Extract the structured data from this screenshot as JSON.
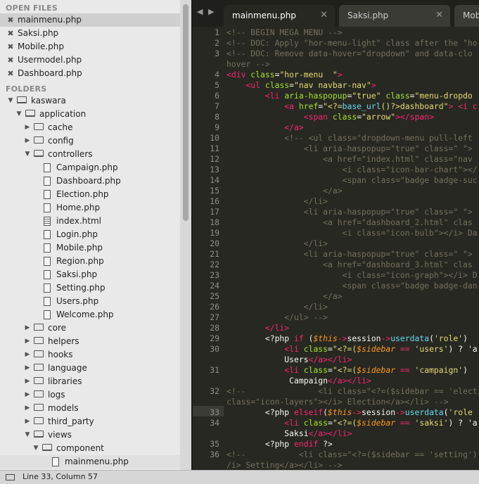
{
  "sidebar": {
    "open_files_title": "OPEN FILES",
    "open_files": [
      {
        "name": "mainmenu.php",
        "close": "✖"
      },
      {
        "name": "Saksi.php",
        "close": "✖"
      },
      {
        "name": "Mobile.php",
        "close": "✖"
      },
      {
        "name": "Usermodel.php",
        "close": "✖"
      },
      {
        "name": "Dashboard.php",
        "close": "✖"
      }
    ],
    "folders_title": "FOLDERS",
    "tree": [
      {
        "label": "kaswara",
        "depth": 0,
        "kind": "folder",
        "open": true
      },
      {
        "label": "application",
        "depth": 1,
        "kind": "folder",
        "open": true
      },
      {
        "label": "cache",
        "depth": 2,
        "kind": "folder",
        "open": false
      },
      {
        "label": "config",
        "depth": 2,
        "kind": "folder",
        "open": false
      },
      {
        "label": "controllers",
        "depth": 2,
        "kind": "folder",
        "open": true
      },
      {
        "label": "Campaign.php",
        "depth": 3,
        "kind": "file"
      },
      {
        "label": "Dashboard.php",
        "depth": 3,
        "kind": "file"
      },
      {
        "label": "Election.php",
        "depth": 3,
        "kind": "file"
      },
      {
        "label": "Home.php",
        "depth": 3,
        "kind": "file"
      },
      {
        "label": "index.html",
        "depth": 3,
        "kind": "file-lines"
      },
      {
        "label": "Login.php",
        "depth": 3,
        "kind": "file"
      },
      {
        "label": "Mobile.php",
        "depth": 3,
        "kind": "file"
      },
      {
        "label": "Region.php",
        "depth": 3,
        "kind": "file"
      },
      {
        "label": "Saksi.php",
        "depth": 3,
        "kind": "file"
      },
      {
        "label": "Setting.php",
        "depth": 3,
        "kind": "file"
      },
      {
        "label": "Users.php",
        "depth": 3,
        "kind": "file"
      },
      {
        "label": "Welcome.php",
        "depth": 3,
        "kind": "file"
      },
      {
        "label": "core",
        "depth": 2,
        "kind": "folder",
        "open": false
      },
      {
        "label": "helpers",
        "depth": 2,
        "kind": "folder",
        "open": false
      },
      {
        "label": "hooks",
        "depth": 2,
        "kind": "folder",
        "open": false
      },
      {
        "label": "language",
        "depth": 2,
        "kind": "folder",
        "open": false
      },
      {
        "label": "libraries",
        "depth": 2,
        "kind": "folder",
        "open": false
      },
      {
        "label": "logs",
        "depth": 2,
        "kind": "folder",
        "open": false
      },
      {
        "label": "models",
        "depth": 2,
        "kind": "folder",
        "open": false
      },
      {
        "label": "third_party",
        "depth": 2,
        "kind": "folder",
        "open": false
      },
      {
        "label": "views",
        "depth": 2,
        "kind": "folder",
        "open": true
      },
      {
        "label": "component",
        "depth": 3,
        "kind": "folder",
        "open": true
      },
      {
        "label": "mainmenu.php",
        "depth": 4,
        "kind": "file"
      }
    ]
  },
  "tabs": [
    {
      "label": "mainmenu.php",
      "close": "✕",
      "active": true
    },
    {
      "label": "Saksi.php",
      "close": "✕",
      "active": false
    },
    {
      "label": "Mob",
      "close": "",
      "active": false
    }
  ],
  "nav": {
    "prev": "◀",
    "next": "▶"
  },
  "editor": {
    "lines": [
      {
        "n": "1",
        "t": [
          [
            "cm",
            "<!-- BEGIN MEGA MENU -->"
          ]
        ]
      },
      {
        "n": "2",
        "t": [
          [
            "cm",
            "<!-- DOC: Apply \"hor-menu-light\" class after the \"ho"
          ]
        ]
      },
      {
        "n": "3",
        "t": [
          [
            "cm",
            "<!-- DOC: Remove data-hover=\"dropdown\" and data-clo"
          ]
        ]
      },
      {
        "n": "",
        "t": [
          [
            "cm",
            "hover -->"
          ]
        ]
      },
      {
        "n": "4",
        "t": [
          [
            "tg",
            "<div "
          ],
          [
            "at",
            "class"
          ],
          [
            "",
            "="
          ],
          [
            "st2",
            "\"hor-menu  \""
          ],
          [
            "tg",
            ">"
          ]
        ]
      },
      {
        "n": "5",
        "t": [
          [
            "",
            "    "
          ],
          [
            "tg",
            "<ul "
          ],
          [
            "at",
            "class"
          ],
          [
            "",
            "="
          ],
          [
            "st2",
            "\"nav navbar-nav\""
          ],
          [
            "tg",
            ">"
          ]
        ]
      },
      {
        "n": "6",
        "t": [
          [
            "",
            "        "
          ],
          [
            "tg",
            "<li "
          ],
          [
            "at",
            "aria-haspopup"
          ],
          [
            "",
            "="
          ],
          [
            "st2",
            "\"true\""
          ],
          [
            "at",
            " class"
          ],
          [
            "",
            "="
          ],
          [
            "st2",
            "\"menu-dropdo"
          ]
        ]
      },
      {
        "n": "7",
        "t": [
          [
            "",
            "            "
          ],
          [
            "tg",
            "<a "
          ],
          [
            "at",
            "href"
          ],
          [
            "",
            "="
          ],
          [
            "st2",
            "\"<?="
          ],
          [
            "fn",
            "base_url"
          ],
          [
            "st2",
            "()?>dashboard\""
          ],
          [
            "tg",
            "> <i c"
          ]
        ]
      },
      {
        "n": "8",
        "t": [
          [
            "",
            "                "
          ],
          [
            "tg",
            "<span "
          ],
          [
            "at",
            "class"
          ],
          [
            "",
            "="
          ],
          [
            "st2",
            "\"arrow\""
          ],
          [
            "tg",
            "></span>"
          ]
        ]
      },
      {
        "n": "9",
        "t": [
          [
            "",
            "            "
          ],
          [
            "tg",
            "</a>"
          ]
        ]
      },
      {
        "n": "10",
        "t": [
          [
            "",
            "            "
          ],
          [
            "cm",
            "<!-- <ul class=\"dropdown-menu pull-left"
          ]
        ]
      },
      {
        "n": "11",
        "t": [
          [
            "",
            "                "
          ],
          [
            "cm",
            "<li aria-haspopup=\"true\" class=\" \">"
          ]
        ]
      },
      {
        "n": "12",
        "t": [
          [
            "",
            "                    "
          ],
          [
            "cm",
            "<a href=\"index.html\" class=\"nav"
          ]
        ]
      },
      {
        "n": "13",
        "t": [
          [
            "",
            "                        "
          ],
          [
            "cm",
            "<i class=\"icon-bar-chart\"></"
          ]
        ]
      },
      {
        "n": "14",
        "t": [
          [
            "",
            "                        "
          ],
          [
            "cm",
            "<span class=\"badge badge-suc"
          ]
        ]
      },
      {
        "n": "15",
        "t": [
          [
            "",
            "                    "
          ],
          [
            "cm",
            "</a>"
          ]
        ]
      },
      {
        "n": "16",
        "t": [
          [
            "",
            "                "
          ],
          [
            "cm",
            "</li>"
          ]
        ]
      },
      {
        "n": "17",
        "t": [
          [
            "",
            "                "
          ],
          [
            "cm",
            "<li aria-haspopup=\"true\" class=\" \">"
          ]
        ]
      },
      {
        "n": "18",
        "t": [
          [
            "",
            "                    "
          ],
          [
            "cm",
            "<a href=\"dashboard_2.html\" clas"
          ]
        ]
      },
      {
        "n": "19",
        "t": [
          [
            "",
            "                        "
          ],
          [
            "cm",
            "<i class=\"icon-bulb\"></i> Da"
          ]
        ]
      },
      {
        "n": "20",
        "t": [
          [
            "",
            "                "
          ],
          [
            "cm",
            "</li>"
          ]
        ]
      },
      {
        "n": "21",
        "t": [
          [
            "",
            "                "
          ],
          [
            "cm",
            "<li aria-haspopup=\"true\" class=\" \">"
          ]
        ]
      },
      {
        "n": "22",
        "t": [
          [
            "",
            "                    "
          ],
          [
            "cm",
            "<a href=\"dashboard_3.html\" clas"
          ]
        ]
      },
      {
        "n": "23",
        "t": [
          [
            "",
            "                        "
          ],
          [
            "cm",
            "<i class=\"icon-graph\"></i> D"
          ]
        ]
      },
      {
        "n": "24",
        "t": [
          [
            "",
            "                        "
          ],
          [
            "cm",
            "<span class=\"badge badge-dan"
          ]
        ]
      },
      {
        "n": "25",
        "t": [
          [
            "",
            "                    "
          ],
          [
            "cm",
            "</a>"
          ]
        ]
      },
      {
        "n": "26",
        "t": [
          [
            "",
            "                "
          ],
          [
            "cm",
            "</li>"
          ]
        ]
      },
      {
        "n": "27",
        "t": [
          [
            "",
            "            "
          ],
          [
            "cm",
            "</ul> -->"
          ]
        ]
      },
      {
        "n": "28",
        "t": [
          [
            "",
            "        "
          ],
          [
            "tg",
            "</li>"
          ]
        ]
      },
      {
        "n": "29",
        "t": [
          [
            "",
            "        <?php "
          ],
          [
            "tg",
            "if "
          ],
          [
            "",
            "("
          ],
          [
            "vr",
            "$this"
          ],
          [
            "tg",
            "->"
          ],
          [
            "",
            "session"
          ],
          [
            "tg",
            "->"
          ],
          [
            "fn",
            "userdata"
          ],
          [
            "",
            "("
          ],
          [
            "st2",
            "'role'"
          ],
          [
            "",
            ") "
          ]
        ]
      },
      {
        "n": "30",
        "t": [
          [
            "",
            "            "
          ],
          [
            "tg",
            "<li "
          ],
          [
            "at",
            "class"
          ],
          [
            "",
            "="
          ],
          [
            "st2",
            "\"<?=("
          ],
          [
            "vr",
            "$sidebar"
          ],
          [
            "tg",
            " == "
          ],
          [
            "st2",
            "'users'"
          ],
          [
            "",
            ") ? 'a"
          ]
        ]
      },
      {
        "n": "",
        "t": [
          [
            "",
            "            Users"
          ],
          [
            "tg",
            "</a></li>"
          ]
        ]
      },
      {
        "n": "31",
        "t": [
          [
            "",
            "            "
          ],
          [
            "tg",
            "<li "
          ],
          [
            "at",
            "class"
          ],
          [
            "",
            "="
          ],
          [
            "st2",
            "\"<?=("
          ],
          [
            "vr",
            "$sidebar"
          ],
          [
            "tg",
            " == "
          ],
          [
            "st2",
            "'campaign'"
          ],
          [
            "",
            ")"
          ]
        ]
      },
      {
        "n": "",
        "t": [
          [
            "",
            "             Campaign"
          ],
          [
            "tg",
            "</a></li>"
          ]
        ]
      },
      {
        "n": "32",
        "t": [
          [
            "cm",
            "<!--               <li class=\"<?=($sidebar == 'electio"
          ]
        ]
      },
      {
        "n": "",
        "t": [
          [
            "cm",
            "class=\"icon-layers\"></i> Election</a></li> -->"
          ]
        ]
      },
      {
        "n": "33",
        "t": [
          [
            "",
            "        <?php "
          ],
          [
            "tg",
            "elseif"
          ],
          [
            "",
            "("
          ],
          [
            "vr",
            "$this"
          ],
          [
            "tg",
            "->"
          ],
          [
            "",
            "session"
          ],
          [
            "tg",
            "->"
          ],
          [
            "fn",
            "userdata"
          ],
          [
            "",
            "("
          ],
          [
            "st2",
            "'role"
          ]
        ]
      },
      {
        "n": "34",
        "t": [
          [
            "",
            "            "
          ],
          [
            "tg",
            "<li "
          ],
          [
            "at",
            "class"
          ],
          [
            "",
            "="
          ],
          [
            "st2",
            "\"<?=("
          ],
          [
            "vr",
            "$sidebar"
          ],
          [
            "tg",
            " == "
          ],
          [
            "st2",
            "'saksi'"
          ],
          [
            "",
            ") ? 'a"
          ]
        ]
      },
      {
        "n": "",
        "t": [
          [
            "",
            "            Saksi"
          ],
          [
            "tg",
            "</a></li>"
          ]
        ]
      },
      {
        "n": "35",
        "t": [
          [
            "",
            "        <?php "
          ],
          [
            "tg",
            "endif "
          ],
          [
            "",
            "?>"
          ]
        ]
      },
      {
        "n": "36",
        "t": [
          [
            "cm",
            "<!--           <li class=\"<?=($sidebar == 'setting')"
          ]
        ]
      },
      {
        "n": "",
        "t": [
          [
            "cm",
            "/i> Setting</a></li> -->"
          ]
        ]
      }
    ]
  },
  "status": {
    "text": "Line 33, Column 57"
  }
}
